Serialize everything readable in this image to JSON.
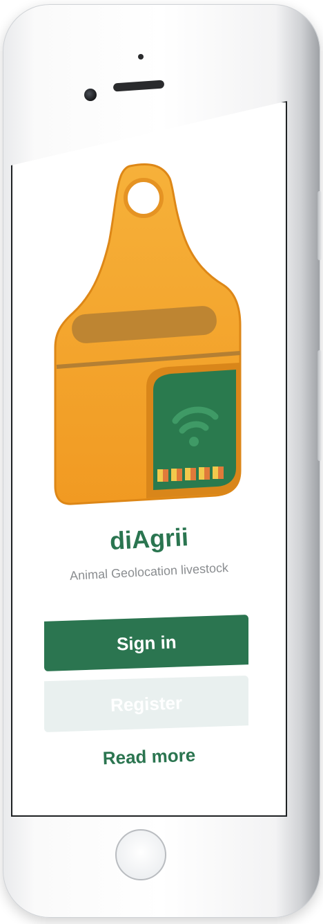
{
  "app": {
    "name": "diAgrii",
    "tagline": "Animal Geolocation livestock"
  },
  "actions": {
    "sign_in_label": "Sign in",
    "register_label": "Register",
    "read_more_label": "Read more"
  },
  "icons": {
    "app_logo": "ear-tag-icon",
    "signal": "wifi-signal-icon"
  },
  "colors": {
    "brand_green": "#2b7550",
    "tag_orange": "#f4a62a",
    "register_disabled_bg": "#e9f0ef",
    "subtitle_gray": "#8a8d90"
  }
}
